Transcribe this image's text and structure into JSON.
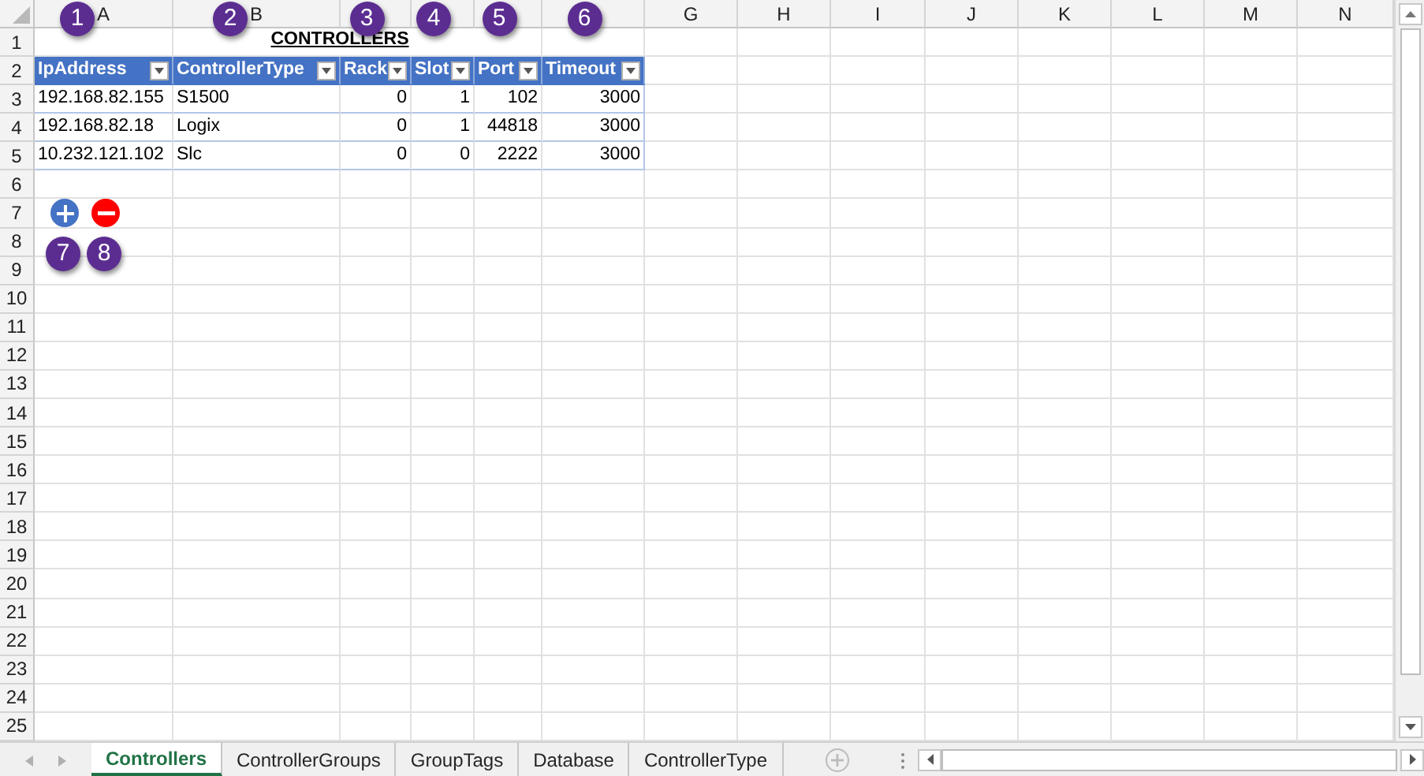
{
  "column_headers": [
    {
      "letter": "A"
    },
    {
      "letter": "B"
    },
    {
      "covered": true
    },
    {
      "covered": true
    },
    {
      "covered": true
    },
    {
      "covered": true
    },
    {
      "letter": "G"
    },
    {
      "letter": "H"
    },
    {
      "letter": "I"
    },
    {
      "letter": "J"
    },
    {
      "letter": "K"
    },
    {
      "letter": "L"
    },
    {
      "letter": "M"
    },
    {
      "letter": "N"
    }
  ],
  "row_numbers": [
    "1",
    "2",
    "3",
    "4",
    "5",
    "6",
    "7",
    "8",
    "9",
    "10",
    "11",
    "12",
    "13",
    "14",
    "15",
    "16",
    "17",
    "18",
    "19",
    "20",
    "21",
    "22",
    "23",
    "24",
    "25"
  ],
  "title": "CONTROLLERS",
  "table": {
    "columns": [
      {
        "label": "IpAddress",
        "kind": "text",
        "callout": "1"
      },
      {
        "label": "ControllerType",
        "kind": "text",
        "callout": "2"
      },
      {
        "label": "Rack",
        "kind": "number",
        "callout": "3"
      },
      {
        "label": "Slot",
        "kind": "number",
        "callout": "4"
      },
      {
        "label": "Port",
        "kind": "number",
        "callout": "5"
      },
      {
        "label": "Timeout",
        "kind": "number",
        "callout": "6"
      }
    ],
    "rows": [
      [
        "192.168.82.155",
        "S1500",
        "0",
        "1",
        "102",
        "3000"
      ],
      [
        "192.168.82.18",
        "Logix",
        "0",
        "1",
        "44818",
        "3000"
      ],
      [
        "10.232.121.102",
        "Slc",
        "0",
        "0",
        "2222",
        "3000"
      ]
    ]
  },
  "buttons": [
    {
      "kind": "add",
      "callout": "7"
    },
    {
      "kind": "remove",
      "callout": "8"
    }
  ],
  "sheet_tabs": [
    {
      "label": "Controllers",
      "selected": true
    },
    {
      "label": "ControllerGroups",
      "selected": false
    },
    {
      "label": "GroupTags",
      "selected": false
    },
    {
      "label": "Database",
      "selected": false
    },
    {
      "label": "ControllerType",
      "selected": false
    }
  ]
}
